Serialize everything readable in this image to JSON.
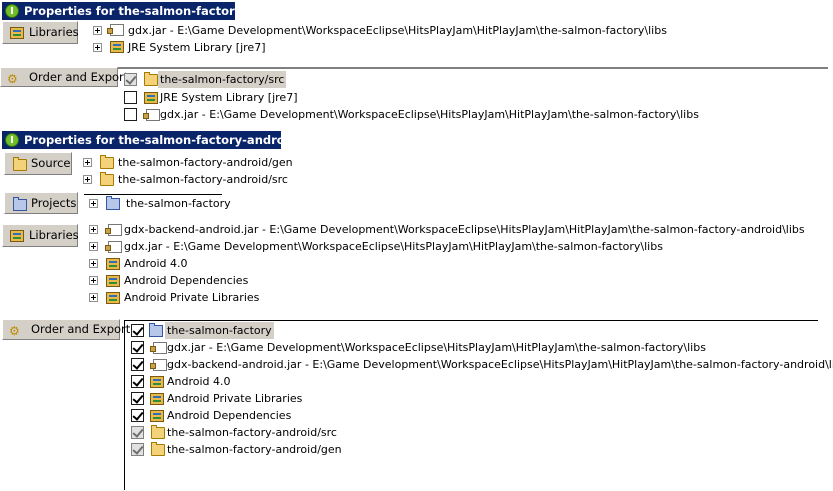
{
  "sec1": {
    "title": "Properties for the-salmon-factory",
    "libraries_tab": "Libraries",
    "libraries": [
      {
        "label": "gdx.jar - E:\\Game Development\\WorkspaceEclipse\\HitsPlayJam\\HitPlayJam\\the-salmon-factory\\libs",
        "icon": "jar-icon"
      },
      {
        "label": "JRE System Library [jre7]",
        "icon": "library-icon"
      }
    ],
    "order_tab": "Order and Export",
    "order": [
      {
        "label": "the-salmon-factory/src",
        "icon": "folder-icon",
        "checked": true,
        "disabled": true,
        "selected": true
      },
      {
        "label": "JRE System Library [jre7]",
        "icon": "library-icon",
        "checked": false
      },
      {
        "label": "gdx.jar - E:\\Game Development\\WorkspaceEclipse\\HitsPlayJam\\HitPlayJam\\the-salmon-factory\\libs",
        "icon": "jar-icon",
        "checked": false
      }
    ]
  },
  "sec2": {
    "title": "Properties for the-salmon-factory-android",
    "source_tab": "Source",
    "source": [
      {
        "label": "the-salmon-factory-android/gen",
        "icon": "folder-icon"
      },
      {
        "label": "the-salmon-factory-android/src",
        "icon": "folder-icon"
      }
    ],
    "projects_tab": "Projects",
    "projects": [
      {
        "label": "the-salmon-factory",
        "icon": "project-icon"
      }
    ],
    "libraries_tab": "Libraries",
    "libraries": [
      {
        "label": "gdx-backend-android.jar - E:\\Game Development\\WorkspaceEclipse\\HitsPlayJam\\HitPlayJam\\the-salmon-factory-android\\libs",
        "icon": "jar-icon"
      },
      {
        "label": "gdx.jar - E:\\Game Development\\WorkspaceEclipse\\HitsPlayJam\\HitPlayJam\\the-salmon-factory\\libs",
        "icon": "jar-icon"
      },
      {
        "label": "Android 4.0",
        "icon": "library-icon"
      },
      {
        "label": "Android Dependencies",
        "icon": "library-icon"
      },
      {
        "label": "Android Private Libraries",
        "icon": "library-icon"
      }
    ],
    "order_tab": "Order and Export",
    "order": [
      {
        "label": "the-salmon-factory",
        "icon": "project-icon",
        "checked": true,
        "selected": true
      },
      {
        "label": "gdx.jar - E:\\Game Development\\WorkspaceEclipse\\HitsPlayJam\\HitPlayJam\\the-salmon-factory\\libs",
        "icon": "jar-icon",
        "checked": true
      },
      {
        "label": "gdx-backend-android.jar - E:\\Game Development\\WorkspaceEclipse\\HitsPlayJam\\HitPlayJam\\the-salmon-factory-android\\libs",
        "icon": "jar-icon",
        "checked": true
      },
      {
        "label": "Android 4.0",
        "icon": "library-icon",
        "checked": true
      },
      {
        "label": "Android Private Libraries",
        "icon": "library-icon",
        "checked": true
      },
      {
        "label": "Android Dependencies",
        "icon": "library-icon",
        "checked": true
      },
      {
        "label": "the-salmon-factory-android/src",
        "icon": "folder-icon",
        "checked": true,
        "disabled": true
      },
      {
        "label": "the-salmon-factory-android/gen",
        "icon": "folder-icon",
        "checked": true,
        "disabled": true
      }
    ]
  }
}
